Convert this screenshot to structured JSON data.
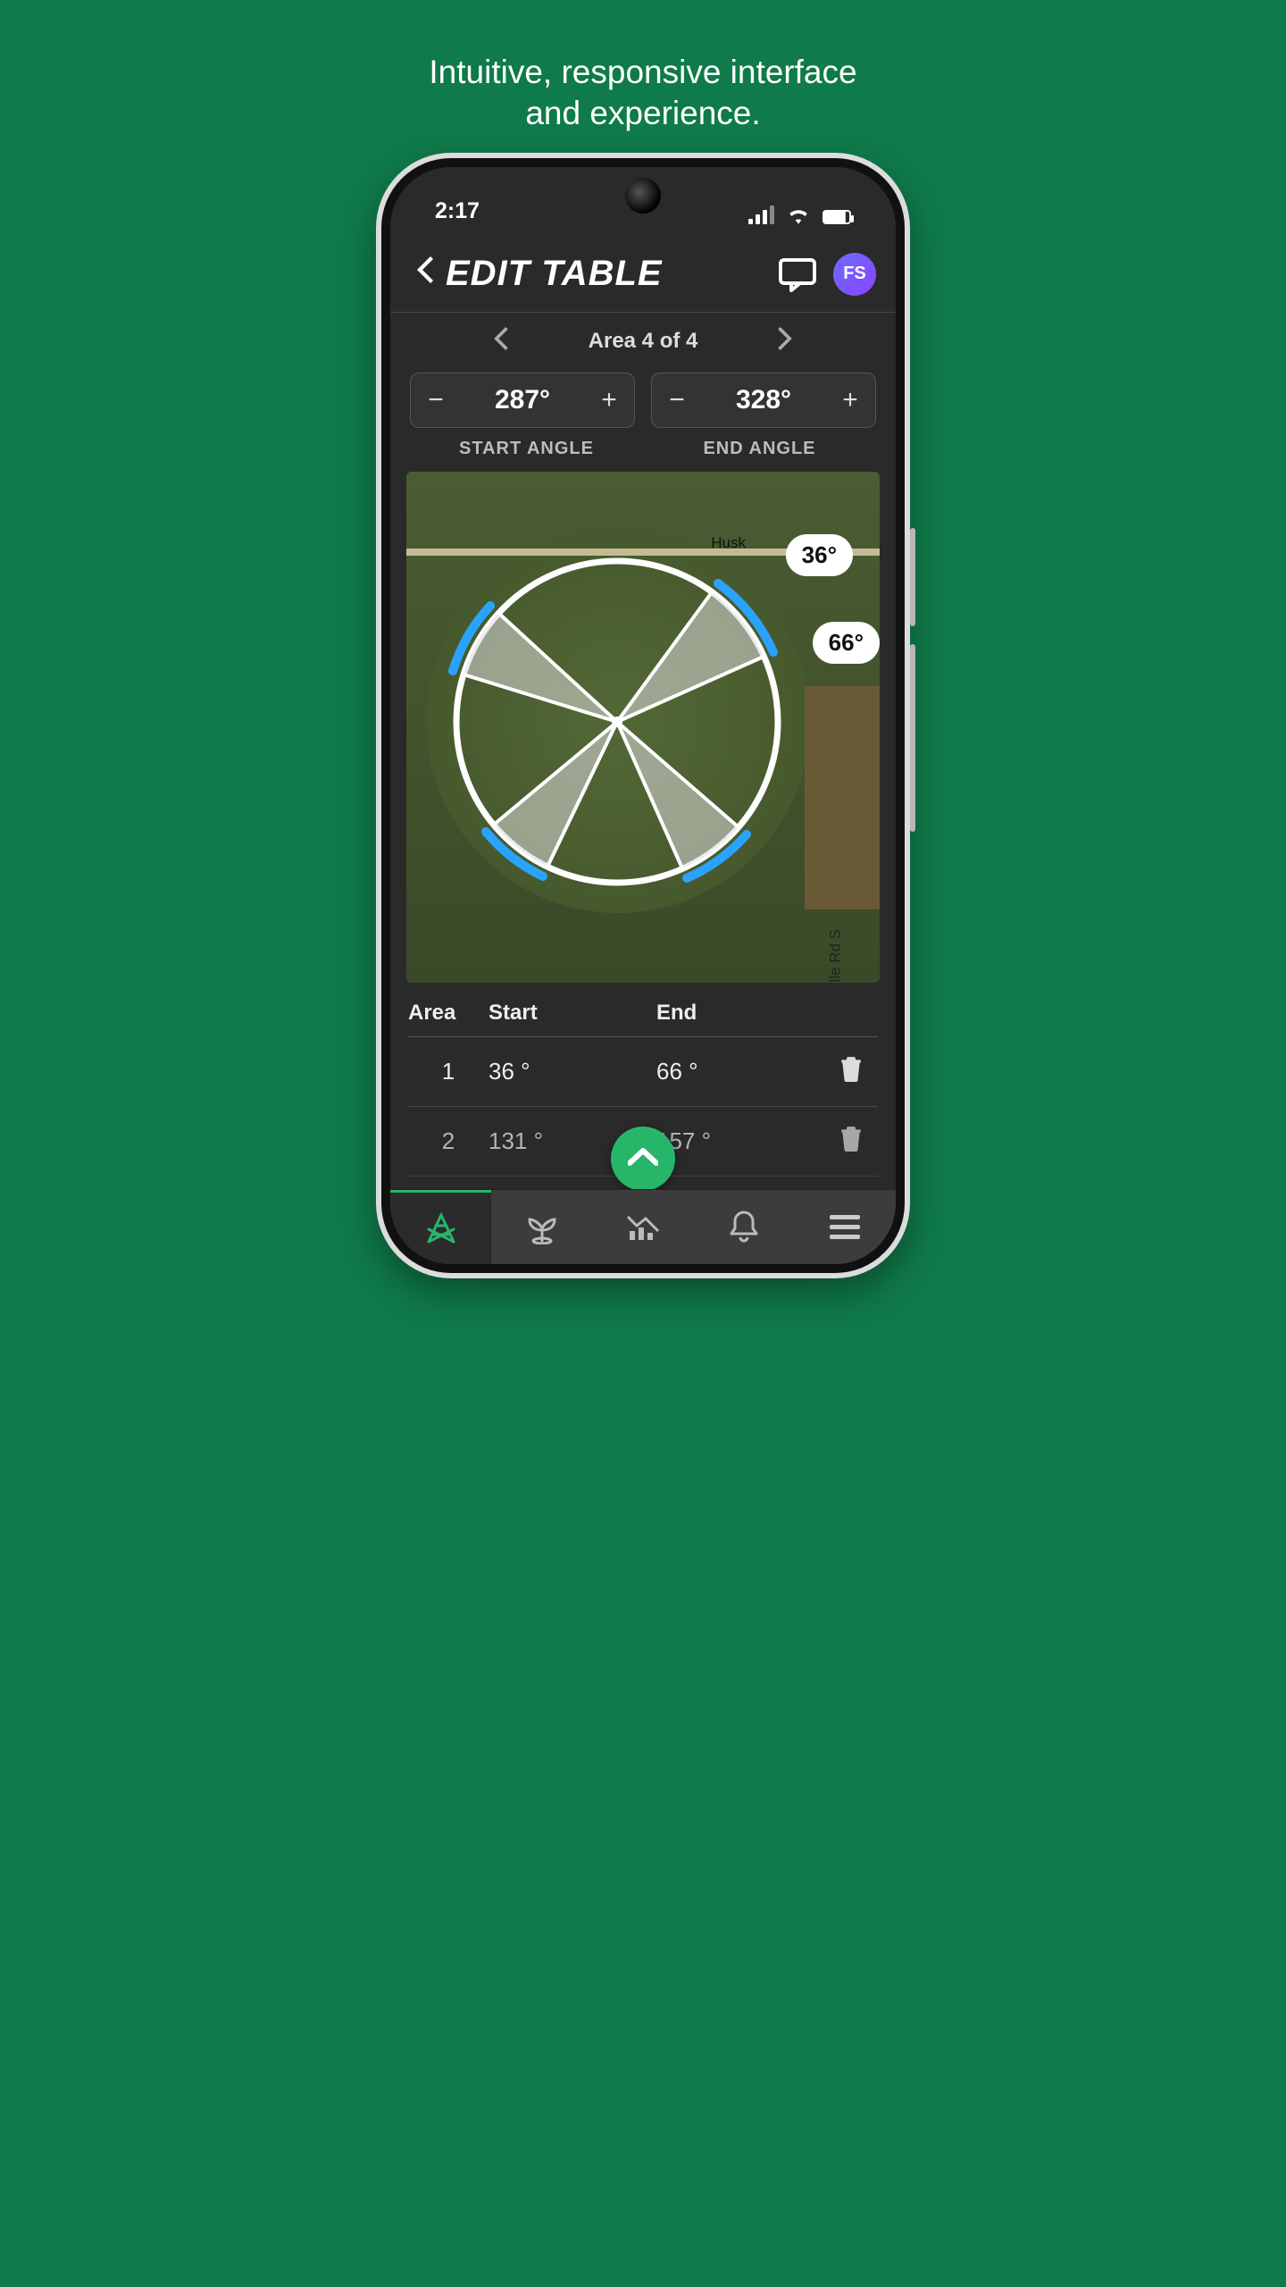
{
  "promo": {
    "line1": "Intuitive, responsive interface",
    "line2": "and experience."
  },
  "status": {
    "time": "2:17"
  },
  "header": {
    "title": "EDIT TABLE",
    "avatar_initials": "FS"
  },
  "area_nav": {
    "label": "Area 4 of 4"
  },
  "angles": {
    "start": {
      "value": "287°",
      "label": "START ANGLE"
    },
    "end": {
      "value": "328°",
      "label": "END ANGLE"
    }
  },
  "map": {
    "road_top": "Husk",
    "road_right": "Schauppsville Rd S",
    "badges": [
      "36°",
      "66°"
    ]
  },
  "table": {
    "headers": {
      "area": "Area",
      "start": "Start",
      "end": "End"
    },
    "rows": [
      {
        "area": "1",
        "start": "36 °",
        "end": "66 °"
      },
      {
        "area": "2",
        "start": "131 °",
        "end": "157 °"
      }
    ]
  },
  "colors": {
    "accent": "#27b56a",
    "blue": "#2aa3ff"
  }
}
